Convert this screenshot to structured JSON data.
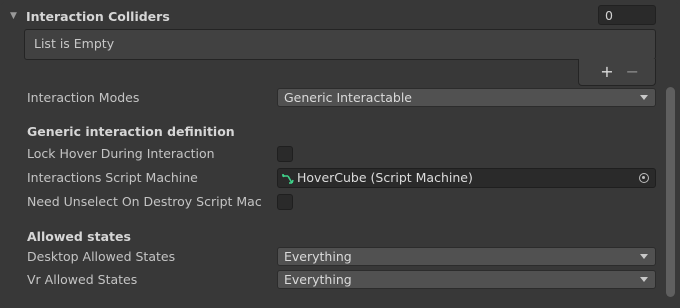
{
  "colliders": {
    "title": "Interaction Colliders",
    "count": "0",
    "empty_text": "List is Empty",
    "add_label": "+",
    "remove_label": "−"
  },
  "interaction_modes": {
    "label": "Interaction Modes",
    "value": "Generic Interactable"
  },
  "generic": {
    "section_title": "Generic interaction definition",
    "lock_hover_label": "Lock Hover During Interaction",
    "lock_hover_checked": false,
    "script_machine_label": "Interactions Script Machine",
    "script_machine_value": "HoverCube (Script Machine)",
    "script_machine_icon": "script-graph-icon",
    "need_unselect_label": "Need Unselect On Destroy Script Mac",
    "need_unselect_checked": false
  },
  "allowed": {
    "section_title": "Allowed states",
    "desktop_label": "Desktop Allowed States",
    "desktop_value": "Everything",
    "vr_label": "Vr Allowed States",
    "vr_value": "Everything"
  },
  "colors": {
    "background": "#383838",
    "field_dark": "#2a2a2a",
    "dropdown": "#515151",
    "icon_green": "#3fd18a"
  }
}
